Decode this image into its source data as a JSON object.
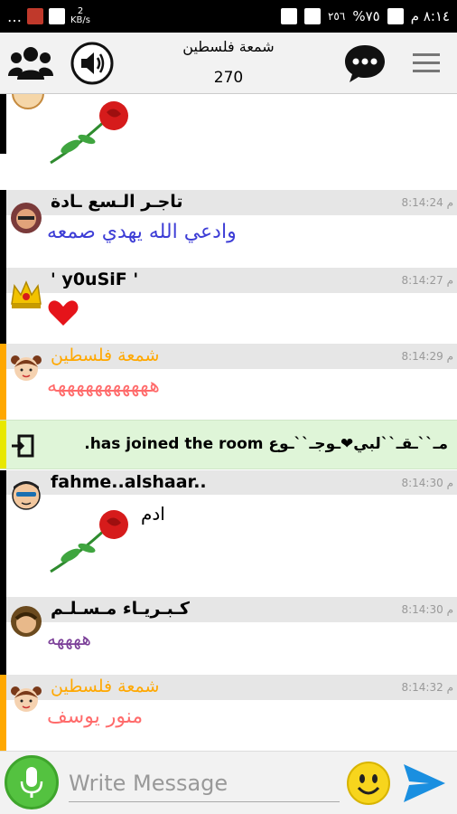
{
  "status_bar": {
    "time": "٨:١٤ م",
    "battery": "%٧٥",
    "network_small": "٢٥٦"
  },
  "toolbar": {
    "room_name": "شمعة فلسطين",
    "user_count": "270"
  },
  "messages": [
    {
      "name": "",
      "time": "",
      "text": "",
      "avatar": "user-avatar",
      "sticker": "rose"
    },
    {
      "name": "تاجـر الـسع ـادة",
      "time": "8:14:24 م",
      "text": "وادعي الله يهدي صمعه",
      "text_color": "#3d3dd6"
    },
    {
      "name": "' y0uSiF '",
      "time": "8:14:27 م",
      "text": "",
      "sticker": "heart"
    },
    {
      "name": "شمعة فلسطين",
      "time": "8:14:29 م",
      "text": "هههههههههههه",
      "text_color": "#ff6b6b"
    },
    {
      "name": "fahme..alshaar..",
      "time": "8:14:30 م",
      "text": "ادم",
      "sticker": "rose"
    },
    {
      "name": "كـبـريـاء مـسـلـم",
      "time": "8:14:30 م",
      "text": "ههههه",
      "text_color": "#7b3f98"
    },
    {
      "name": "شمعة فلسطين",
      "time": "8:14:32 م",
      "text": "منور يوسف",
      "text_color": "#ff6b6b"
    }
  ],
  "join_notice": {
    "text": "مـ``ـقـ``لبي❤ـوجـ``ـوع has joined the room."
  },
  "input": {
    "placeholder": "Write Message"
  },
  "colors": {
    "accent_orange": "#ffa800",
    "mic_green": "#54c240",
    "send_blue": "#1a8fe0",
    "join_bg": "#dff5d8"
  }
}
